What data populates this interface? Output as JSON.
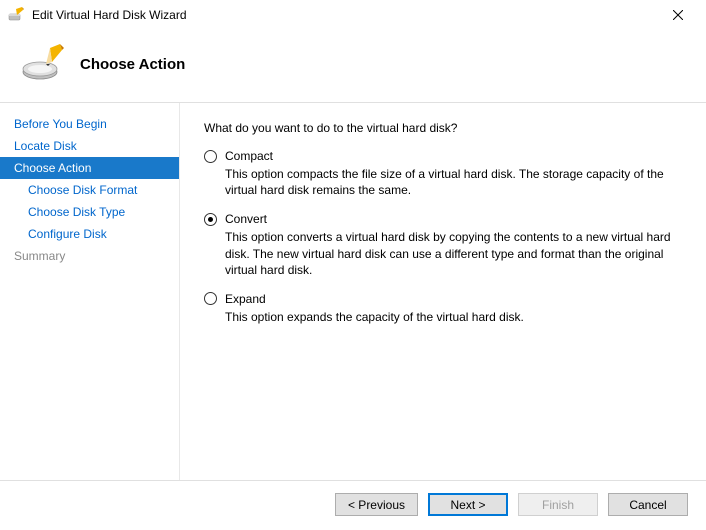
{
  "window": {
    "title": "Edit Virtual Hard Disk Wizard"
  },
  "header": {
    "title": "Choose Action"
  },
  "sidebar": {
    "items": [
      {
        "label": "Before You Begin",
        "indent": false,
        "selected": false,
        "disabled": false
      },
      {
        "label": "Locate Disk",
        "indent": false,
        "selected": false,
        "disabled": false
      },
      {
        "label": "Choose Action",
        "indent": false,
        "selected": true,
        "disabled": false
      },
      {
        "label": "Choose Disk Format",
        "indent": true,
        "selected": false,
        "disabled": false
      },
      {
        "label": "Choose Disk Type",
        "indent": true,
        "selected": false,
        "disabled": false
      },
      {
        "label": "Configure Disk",
        "indent": true,
        "selected": false,
        "disabled": false
      },
      {
        "label": "Summary",
        "indent": false,
        "selected": false,
        "disabled": true
      }
    ]
  },
  "content": {
    "prompt": "What do you want to do to the virtual hard disk?",
    "options": [
      {
        "label": "Compact",
        "description": "This option compacts the file size of a virtual hard disk. The storage capacity of the virtual hard disk remains the same.",
        "checked": false
      },
      {
        "label": "Convert",
        "description": "This option converts a virtual hard disk by copying the contents to a new virtual hard disk. The new virtual hard disk can use a different type and format than the original virtual hard disk.",
        "checked": true
      },
      {
        "label": "Expand",
        "description": "This option expands the capacity of the virtual hard disk.",
        "checked": false
      }
    ]
  },
  "footer": {
    "previous": "< Previous",
    "next": "Next >",
    "finish": "Finish",
    "cancel": "Cancel"
  }
}
